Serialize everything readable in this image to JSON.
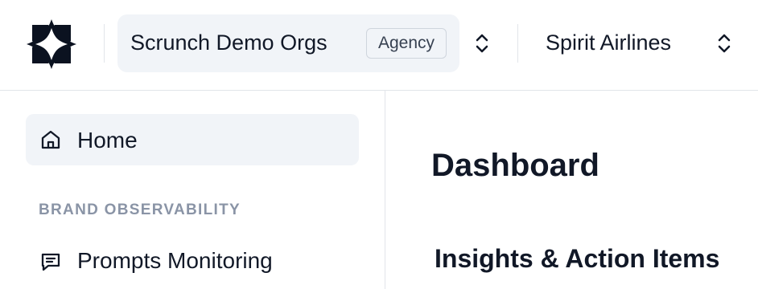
{
  "header": {
    "org_name": "Scrunch Demo Orgs",
    "org_badge": "Agency",
    "brand_name": "Spirit Airlines"
  },
  "sidebar": {
    "home_label": "Home",
    "section_title": "BRAND OBSERVABILITY",
    "items": [
      {
        "label": "Prompts Monitoring",
        "icon": "chat-message-icon"
      }
    ]
  },
  "main": {
    "title": "Dashboard",
    "section_heading": "Insights & Action Items"
  }
}
